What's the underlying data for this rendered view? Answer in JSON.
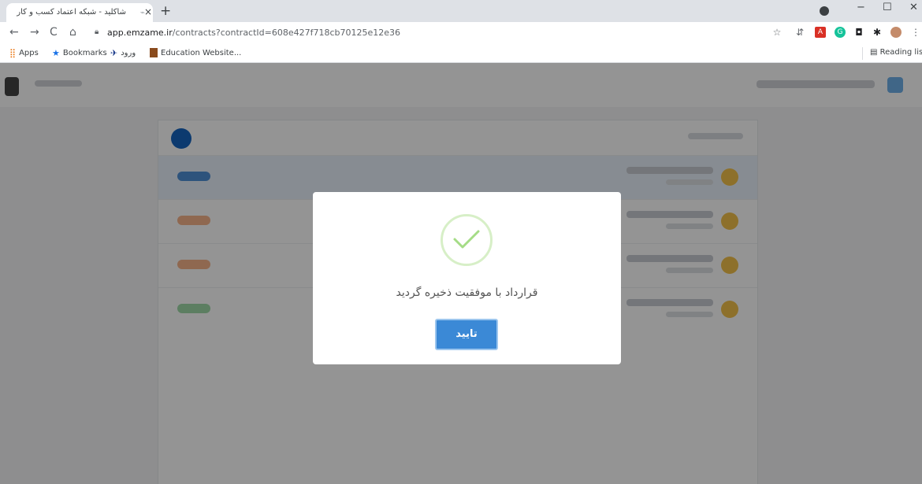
{
  "browser": {
    "tab_title": "شاکلید - شبکه اعتماد کسب و کار",
    "tab_close": "×",
    "new_tab": "+",
    "window_controls": [
      "−",
      "☐",
      "✕"
    ],
    "nav": {
      "back": "←",
      "forward": "→",
      "reload": "C",
      "home": "⌂"
    },
    "url_host": "app.emzame.ir",
    "url_path": "/contracts?contractId=608e427f718cb70125e12e36",
    "bookmarks": [
      {
        "label": "Apps",
        "icon": "apps-grid-icon"
      },
      {
        "label": "Bookmarks",
        "icon": "star-icon"
      },
      {
        "label": "ورود",
        "icon": "bird-icon"
      },
      {
        "label": "Education Website...",
        "icon": "book-icon"
      }
    ],
    "reading_list": "Reading list"
  },
  "modal": {
    "message": "قرارداد با موفقیت ذخیره گردید",
    "confirm_label": "تایید"
  },
  "colors": {
    "confirm_button": "#3b89d6",
    "success_check": "#a5dc86",
    "overlay": "rgba(0,0,0,0.42)"
  }
}
